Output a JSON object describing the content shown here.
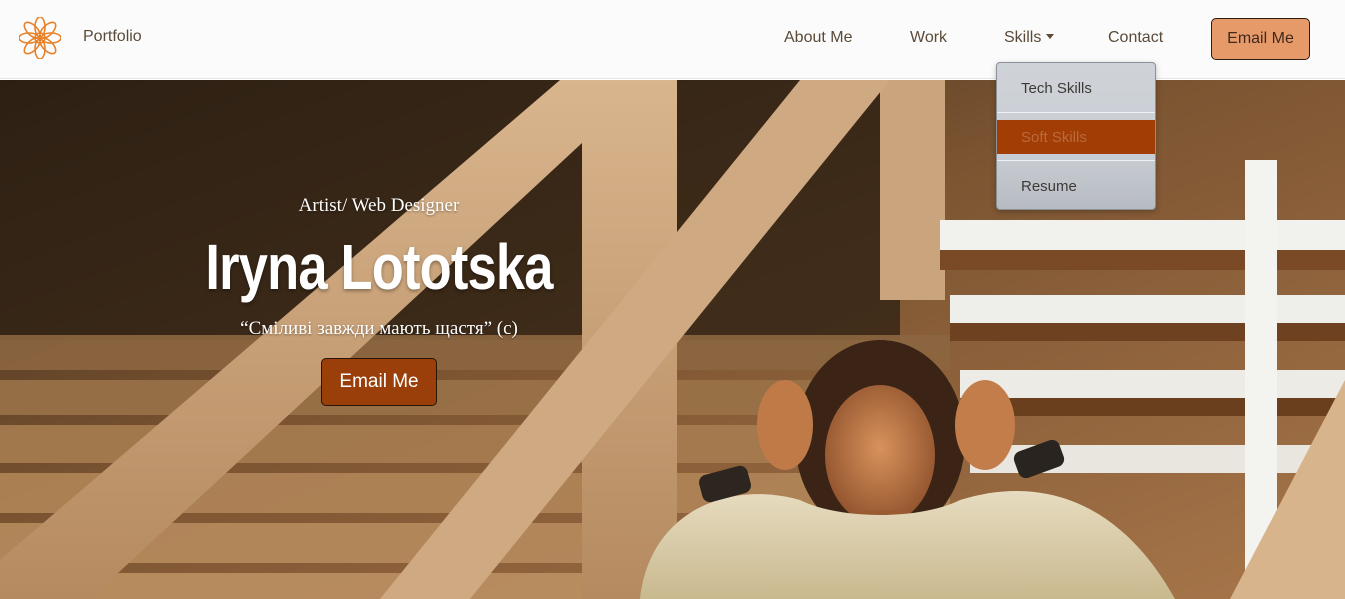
{
  "navbar": {
    "brand": "Portfolio",
    "logo_icon": "flower-mandala-icon",
    "links": {
      "about": "About Me",
      "work": "Work",
      "skills": "Skills",
      "contact": "Contact"
    },
    "cta": "Email Me"
  },
  "dropdown": {
    "items": [
      "Tech Skills",
      "Soft Skills",
      "Resume"
    ],
    "active_index": 1
  },
  "hero": {
    "subtitle": "Artist/ Web Designer",
    "title": "Iryna Lototska",
    "quote": "“Сміливі завжди мають щастя” (с)",
    "cta": "Email Me"
  },
  "colors": {
    "accent": "#e69a6a",
    "hero_button": "#9a3e0a",
    "dropdown_active": "#a23d06"
  }
}
